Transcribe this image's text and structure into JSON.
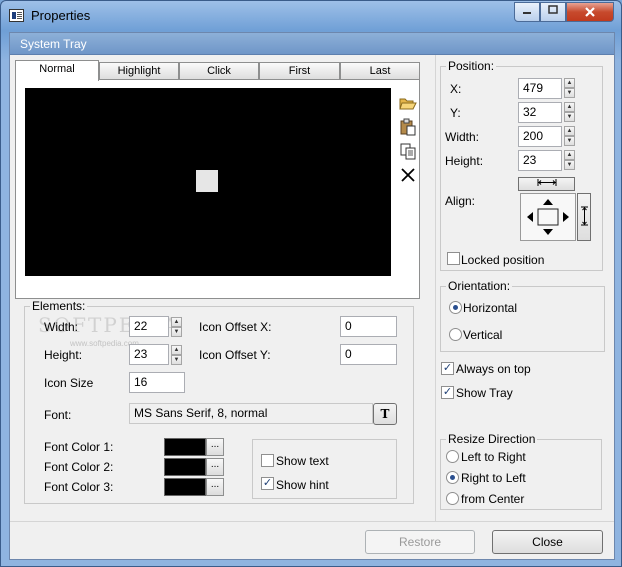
{
  "window": {
    "title": "Properties"
  },
  "header": {
    "title": "System Tray"
  },
  "tabs": [
    {
      "label": "Normal"
    },
    {
      "label": "Highlight"
    },
    {
      "label": "Click"
    },
    {
      "label": "First"
    },
    {
      "label": "Last"
    }
  ],
  "toolbar": [
    {
      "icon": "folder-open-icon"
    },
    {
      "icon": "paste-icon"
    },
    {
      "icon": "copy-icon"
    },
    {
      "icon": "delete-icon"
    }
  ],
  "elements": {
    "legend": "Elements:",
    "width": {
      "label": "Width:",
      "value": "22"
    },
    "height": {
      "label": "Height:",
      "value": "23"
    },
    "icon_offset_x": {
      "label": "Icon Offset X:",
      "value": "0"
    },
    "icon_offset_y": {
      "label": "Icon Offset Y:",
      "value": "0"
    },
    "icon_size": {
      "label": "Icon Size",
      "value": "16"
    },
    "font": {
      "label": "Font:",
      "value": "MS Sans Serif, 8, normal",
      "button": "T"
    },
    "font_color_1": {
      "label": "Font Color 1:",
      "color": "#000000"
    },
    "font_color_2": {
      "label": "Font Color 2:",
      "color": "#000000"
    },
    "font_color_3": {
      "label": "Font Color 3:",
      "color": "#000000"
    },
    "ellipsis": "...",
    "show_text": {
      "label": "Show text",
      "checked": false
    },
    "show_hint": {
      "label": "Show hint",
      "checked": true
    }
  },
  "position": {
    "legend": "Position:",
    "x": {
      "label": "X:",
      "value": "479"
    },
    "y": {
      "label": "Y:",
      "value": "32"
    },
    "width": {
      "label": "Width:",
      "value": "200"
    },
    "height": {
      "label": "Height:",
      "value": "23"
    },
    "align_label": "Align:",
    "locked": {
      "label": "Locked position",
      "checked": false
    }
  },
  "orientation": {
    "legend": "Orientation:",
    "options": [
      {
        "label": "Horizontal",
        "selected": true
      },
      {
        "label": "Vertical",
        "selected": false
      }
    ]
  },
  "always_on_top": {
    "label": "Always on top",
    "checked": true
  },
  "show_tray": {
    "label": "Show Tray",
    "checked": true
  },
  "resize_direction": {
    "legend": "Resize Direction",
    "options": [
      {
        "label": "Left to Right",
        "selected": false
      },
      {
        "label": "Right to Left",
        "selected": true
      },
      {
        "label": "from Center",
        "selected": false
      }
    ]
  },
  "buttons": {
    "restore": "Restore",
    "close": "Close"
  },
  "watermark": {
    "text": "SOFTPEDIA",
    "url": "www.softpedia.com"
  }
}
